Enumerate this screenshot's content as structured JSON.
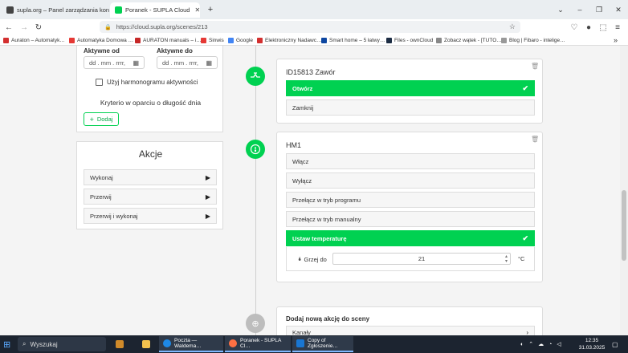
{
  "browser": {
    "tabs": [
      {
        "title": "supla.org – Panel zarządzania konte…",
        "active": false,
        "favicon_color": "#444444"
      },
      {
        "title": "Poranek - SUPLA Cloud",
        "active": true,
        "favicon_color": "#00d151"
      }
    ],
    "new_tab": "+",
    "tab_list": "⌄",
    "window": {
      "minimize": "–",
      "maximize": "❐",
      "close": "✕"
    },
    "url": "https://cloud.supla.org/scenes/213",
    "bookmarks": [
      {
        "label": "Auraton – Automatyk…",
        "color": "#d32f2f"
      },
      {
        "label": "Automatyka Domowa …",
        "color": "#e53935"
      },
      {
        "label": "AURATON manuals – i…",
        "color": "#c62828"
      },
      {
        "label": "Sinwis",
        "color": "#e53935"
      },
      {
        "label": "Google",
        "color": "#4285f4"
      },
      {
        "label": "Elektroniczny Nadawc…",
        "color": "#d32f2f"
      },
      {
        "label": "Smart home – 5 łatwy…",
        "color": "#0d47a1"
      },
      {
        "label": "Files - ownCloud",
        "color": "#1d2d44"
      },
      {
        "label": "Zobacz wątek - [TUTO…",
        "color": "#888888"
      },
      {
        "label": "Blog | Fibaro - intelige…",
        "color": "#999999"
      }
    ],
    "bookmarks_more": "»"
  },
  "left_panel": {
    "active_from_label": "Aktywne od",
    "active_to_label": "Aktywne do",
    "date_placeholder": "dd . mm . rrrr,",
    "schedule_checkbox_label": "Użyj harmonogramu aktywności",
    "criteria_title": "Kryterio w oparciu o długość dnia",
    "add_button": "Dodaj",
    "actions_title": "Akcje",
    "actions": [
      "Wykonaj",
      "Przerwij",
      "Przerwij i wykonaj"
    ]
  },
  "scene": {
    "operations": [
      {
        "title": "ID15813 Zawór",
        "icon": "valve-icon",
        "actions": [
          {
            "label": "Otwórz",
            "selected": true
          },
          {
            "label": "Zamknij",
            "selected": false
          }
        ]
      },
      {
        "title": "HM1",
        "icon": "thermostat-icon",
        "actions": [
          {
            "label": "Włącz",
            "selected": false
          },
          {
            "label": "Wyłącz",
            "selected": false
          },
          {
            "label": "Przełącz w tryb programu",
            "selected": false
          },
          {
            "label": "Przełącz w tryb manualny",
            "selected": false
          },
          {
            "label": "Ustaw temperaturę",
            "selected": true
          }
        ],
        "param_label": "Grzej do",
        "param_value": "21",
        "param_unit": "°C"
      }
    ],
    "add_action_title": "Dodaj nową akcję do sceny",
    "add_action_option": "Kanały"
  },
  "taskbar": {
    "search": "Wyszukaj",
    "apps": [
      {
        "label": "",
        "color": "#d08a2a",
        "open": false
      },
      {
        "label": "",
        "color": "#f2c14e",
        "open": false
      },
      {
        "label": "Poczta — Waldema…",
        "color": "#1e88e5",
        "open": true
      },
      {
        "label": "Poranek - SUPLA Cl…",
        "color": "#ff7043",
        "open": true
      },
      {
        "label": "Copy of Zgłoszenie…",
        "color": "#1976d2",
        "open": true
      }
    ],
    "time": "12:35",
    "date": "31.03.2025"
  },
  "colors": {
    "accent": "#00d151",
    "taskbar": "#1c2430"
  }
}
